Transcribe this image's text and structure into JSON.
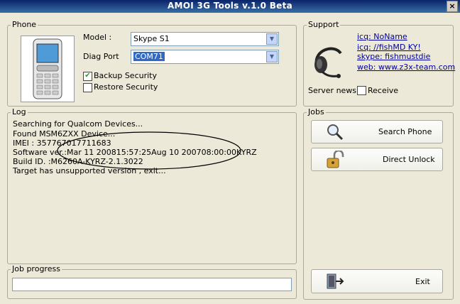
{
  "window": {
    "title": "AMOI 3G Tools v.1.0 Beta",
    "close_glyph": "×"
  },
  "phone": {
    "group_label": "Phone",
    "model_label": "Model :",
    "model_value": "Skype S1",
    "port_label": "Diag Port",
    "port_value": "COM71",
    "backup_security": {
      "label": "Backup Security",
      "checked": true
    },
    "restore_security": {
      "label": "Restore Security",
      "checked": false
    }
  },
  "support": {
    "group_label": "Support",
    "links": [
      "icq: NoName",
      "icq: //fishMD KY!",
      "skype: fishmustdie",
      "web: www.z3x-team.com"
    ],
    "server_news_label": "Server news:",
    "receive_label": "Receive",
    "receive_checked": false
  },
  "log": {
    "group_label": "Log",
    "lines": [
      "Searching for Qualcom Devices...",
      "Found MSM6ZXX Device...",
      "IMEI : 357767017711683",
      "Software ver.:Mar 11 200815:57:25Aug 10 200708:00:00KYRZ",
      "Build ID. :M6260A-KYRZ-2.1.3022",
      "Target has unsupported version , exit..."
    ]
  },
  "jobs": {
    "group_label": "Jobs",
    "buttons": {
      "search_phone": "Search Phone",
      "direct_unlock": "Direct Unlock",
      "exit": "Exit"
    }
  },
  "job_progress": {
    "group_label": "Job progress",
    "percent": 0
  },
  "icons": [
    "phone-image",
    "headset-icon",
    "magnifier-icon",
    "padlock-icon",
    "exit-icon",
    "chevron-down-icon"
  ]
}
